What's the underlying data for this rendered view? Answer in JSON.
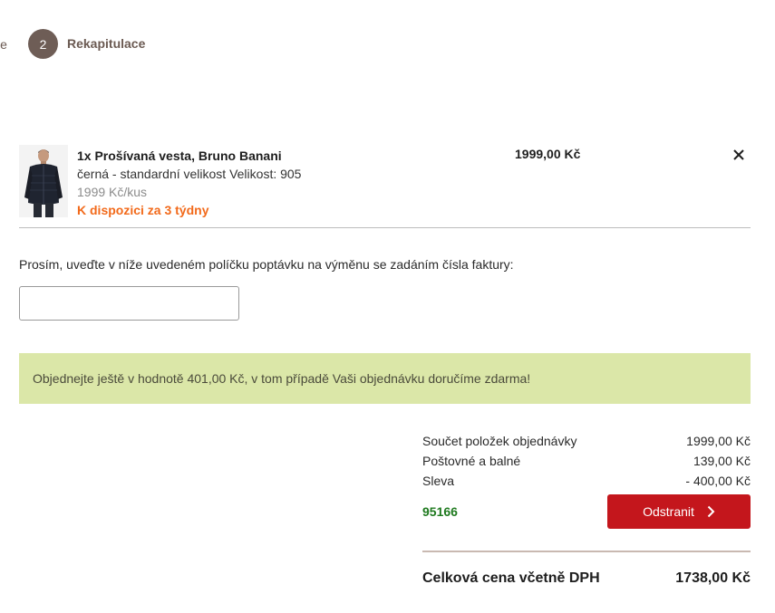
{
  "stepper": {
    "prev_step_label_partial": "je",
    "current_step_number": "2",
    "current_step_label": "Rekapitulace"
  },
  "cart": {
    "items": [
      {
        "title": "1x Prošívaná vesta, Bruno Banani",
        "variant": "černá - standardní velikost Velikost: 905",
        "unit_price": "1999 Kč/kus",
        "availability": "K dispozici za 3 týdny",
        "price": "1999,00 Kč"
      }
    ]
  },
  "exchange": {
    "label": "Prosím, uveďte v níže uvedeném políčku poptávku na výměnu se zadáním čísla faktury:",
    "value": "",
    "placeholder": ""
  },
  "notice": {
    "free_shipping": "Objednejte ještě v hodnotě 401,00 Kč, v tom případě Vaši objednávku doručíme zdarma!"
  },
  "summary": {
    "rows": [
      {
        "label": "Součet položek objednávky",
        "value": "1999,00 Kč"
      },
      {
        "label": "Poštovné a balné",
        "value": "139,00 Kč"
      },
      {
        "label": "Sleva",
        "value": "- 400,00 Kč"
      }
    ],
    "coupon_code": "95166",
    "remove_coupon_label": "Odstranit",
    "total_label": "Celková cena včetně DPH",
    "total_value": "1738,00 Kč"
  },
  "colors": {
    "accent_red": "#c4161c",
    "availability_orange": "#f26a1b",
    "notice_green": "#dbe7a8",
    "coupon_green": "#1f7a1f",
    "step_brown": "#6e5d56"
  }
}
